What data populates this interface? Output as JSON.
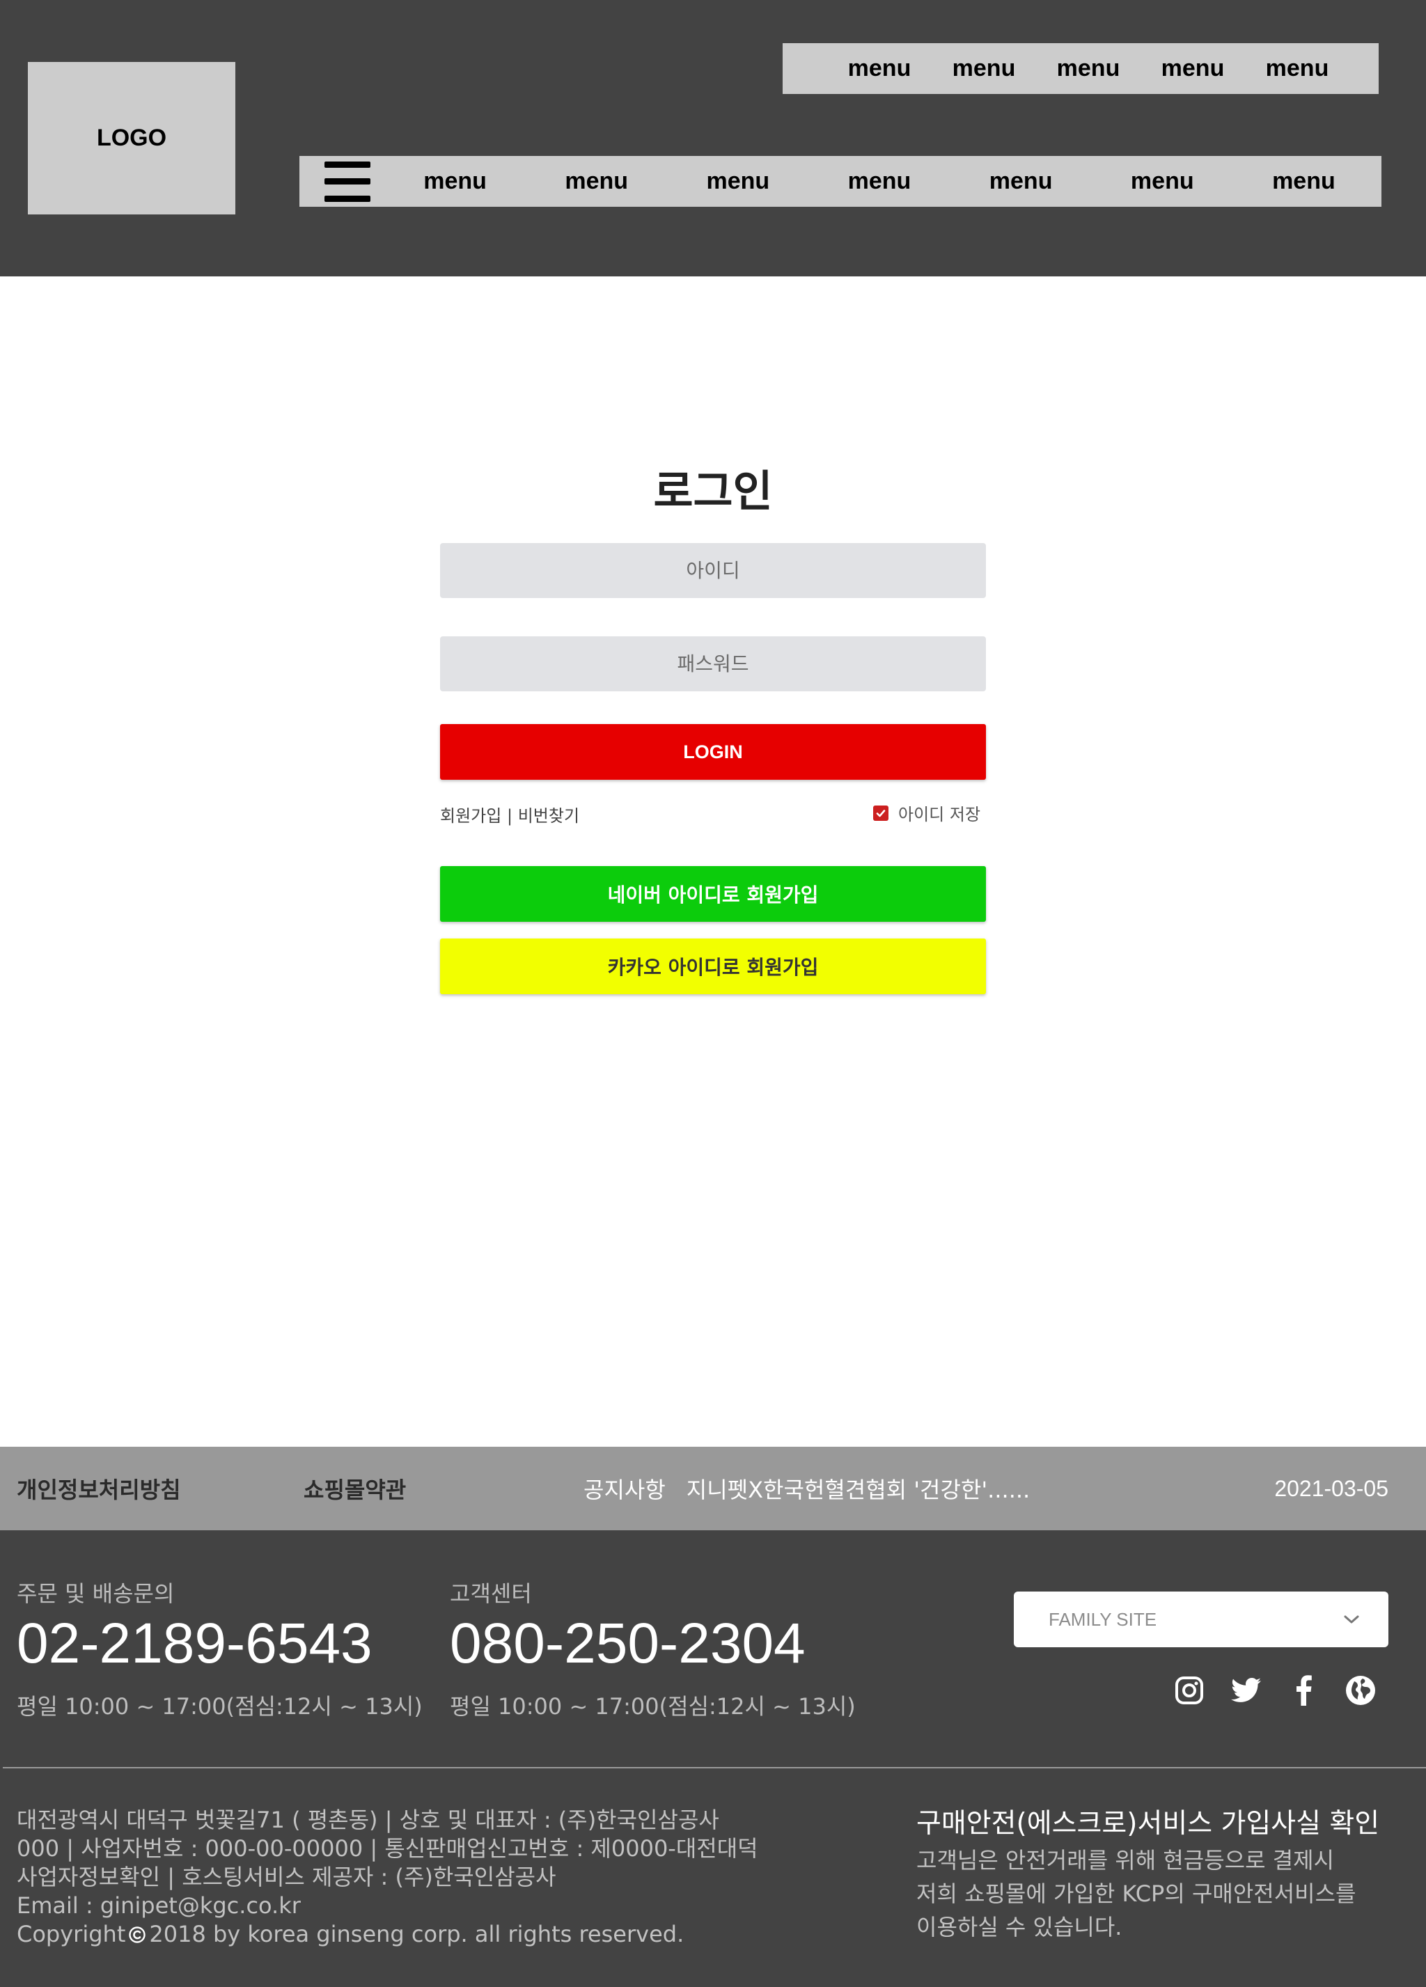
{
  "header": {
    "logo": "LOGO",
    "top_menu": [
      "menu",
      "menu",
      "menu",
      "menu",
      "menu"
    ],
    "main_menu": [
      "menu",
      "menu",
      "menu",
      "menu",
      "menu",
      "menu",
      "menu"
    ]
  },
  "login": {
    "title": "로그인",
    "id_placeholder": "아이디",
    "password_placeholder": "패스워드",
    "login_button": "LOGIN",
    "signup_link": "회원가입",
    "separator": "|",
    "find_password_link": "비번찾기",
    "remember_id_label": "아이디 저장",
    "naver_button": "네이버 아이디로 회원가입",
    "kakao_button": "카카오 아이디로 회원가입"
  },
  "notice_bar": {
    "privacy": "개인정보처리방침",
    "terms": "쇼핑몰약관",
    "notice_label": "공지사항",
    "notice_text": "지니펫X한국헌혈견협회 '건강한'......",
    "notice_date": "2021-03-05"
  },
  "footer": {
    "order_label": "주문 및 배송문의",
    "order_phone": "02-2189-6543",
    "order_hours": "평일 10:00 ~ 17:00(점심:12시 ~ 13시)",
    "cs_label": "고객센터",
    "cs_phone": "080-250-2304",
    "cs_hours": "평일 10:00 ~ 17:00(점심:12시 ~ 13시)",
    "family_site": "FAMILY SITE",
    "social_icons": [
      "instagram-icon",
      "twitter-icon",
      "facebook-icon",
      "globe-icon"
    ],
    "company_lines": [
      "대전광역시 대덕구 벗꽃길71 ( 평촌동) | 상호 및 대표자 : (주)한국인삼공사",
      "000 | 사업자번호 : 000-00-00000 | 통신판매업신고번호 : 제0000-대전대덕",
      "사업자정보확인 | 호스팅서비스 제공자 : (주)한국인삼공사",
      "Email : ginipet@kgc.co.kr"
    ],
    "copyright_prefix": "Copyright",
    "copyright_rest": " 2018 by korea ginseng corp. all rights reserved.",
    "escrow_title": "구매안전(에스크로)서비스 가입사실 확인",
    "escrow_lines": [
      "고객님은 안전거래를 위해 현금등으로 결제시",
      "저희 쇼핑몰에 가입한 KCP의 구매안전서비스를",
      "이용하실 수 있습니다."
    ]
  },
  "colors": {
    "header_bg": "#434343",
    "menu_bg": "#cccccc",
    "login_button": "#e60000",
    "naver": "#0ccc0c",
    "kakao": "#f2ff00",
    "notice_bar": "#999999",
    "checkbox": "#cc1f1f"
  }
}
